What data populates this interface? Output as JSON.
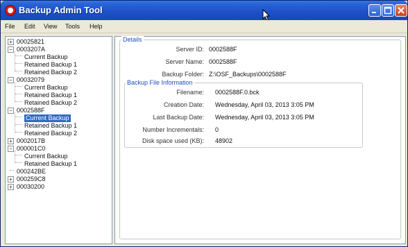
{
  "window": {
    "title": "Backup Admin Tool"
  },
  "menu": [
    "File",
    "Edit",
    "View",
    "Tools",
    "Help"
  ],
  "tree": [
    {
      "label": "00025821",
      "expander": "+"
    },
    {
      "label": "0003207A",
      "expander": "−"
    },
    {
      "label": "Current Backup"
    },
    {
      "label": "Retained Backup 1"
    },
    {
      "label": "Retained Backup 2"
    },
    {
      "label": "00032079",
      "expander": "−"
    },
    {
      "label": "Current Backup"
    },
    {
      "label": "Retained Backup 1"
    },
    {
      "label": "Retained Backup 2"
    },
    {
      "label": "0002588F",
      "expander": "−"
    },
    {
      "label": "Current Backup",
      "selected": true
    },
    {
      "label": "Retained Backup 1"
    },
    {
      "label": "Retained Backup 2"
    },
    {
      "label": "0002017B",
      "expander": "+"
    },
    {
      "label": "000001C0",
      "expander": "−"
    },
    {
      "label": "Current Backup"
    },
    {
      "label": "Retained Backup 1"
    },
    {
      "label": "000242BE"
    },
    {
      "label": "000259C8",
      "expander": "+"
    },
    {
      "label": "00030200",
      "expander": "+"
    }
  ],
  "details": {
    "legend": "Details",
    "server_id_label": "Server ID:",
    "server_id": "0002588F",
    "server_name_label": "Server Name:",
    "server_name": "0002588F",
    "backup_folder_label": "Backup Folder:",
    "backup_folder": "Z:\\OSF_Backups\\0002588F"
  },
  "file_info": {
    "legend": "Backup File Information",
    "filename_label": "Filename:",
    "filename": "0002588F.0.bck",
    "creation_date_label": "Creation Date:",
    "creation_date": "Wednesday, April 03, 2013 3:05 PM",
    "last_backup_label": "Last Backup Date:",
    "last_backup": "Wednesday, April 03, 2013 3:05 PM",
    "incrementals_label": "Number Incrementals:",
    "incrementals": "0",
    "disk_space_label": "Disk space used (KB):",
    "disk_space": "48902"
  },
  "colors": {
    "titlebar": "#2a64d6",
    "selection": "#316ac5",
    "close_button": "#c8421e"
  }
}
